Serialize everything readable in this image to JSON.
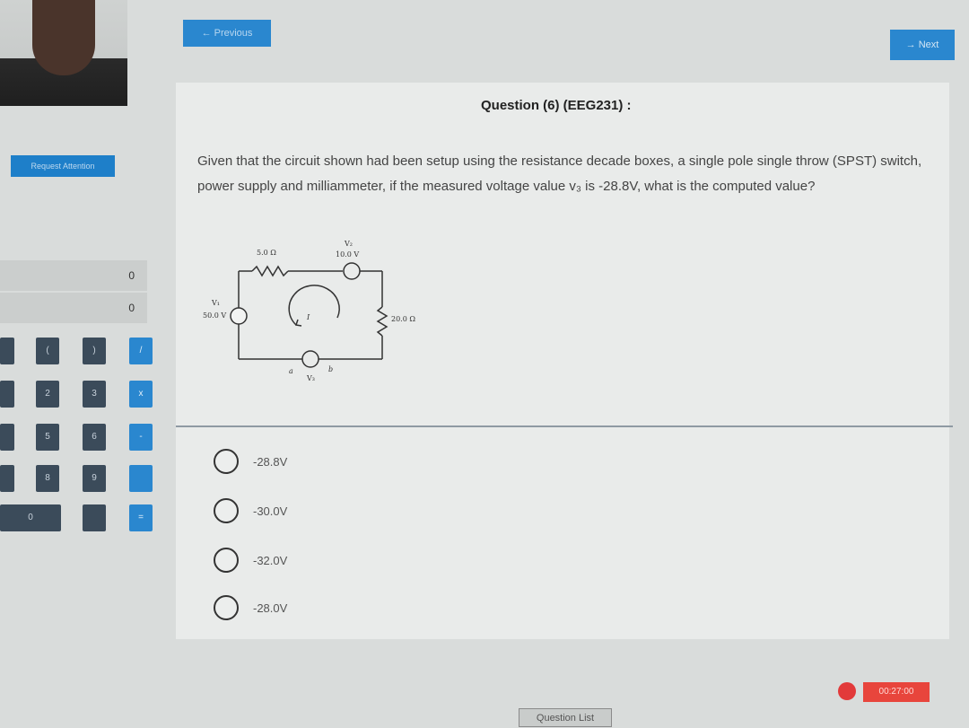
{
  "proctor": {
    "request_label": "Request Attention"
  },
  "nav": {
    "previous_label": "← Previous",
    "next_label": "→ Next"
  },
  "question": {
    "title": "Question (6) (EEG231) :",
    "text": "Given that the circuit shown had been setup using the resistance decade boxes, a single pole single throw (SPST) switch, power supply and milliammeter, if the measured voltage value v₃ is -28.8V, what is the computed value?",
    "circuit": {
      "r1_label": "5.0 Ω",
      "r2_label": "20.0 Ω",
      "v1_name": "V₁",
      "v1_value": "50.0 V",
      "v2_name": "V₂",
      "v2_value": "10.0 V",
      "current_label": "I",
      "node_a": "a",
      "node_b": "b",
      "v3_name": "V₃"
    },
    "options": [
      "-28.8V",
      "-30.0V",
      "-32.0V",
      "-28.0V"
    ]
  },
  "calculator": {
    "display_top": "0",
    "display_bottom": "0",
    "keys": [
      [
        "(",
        ")",
        "/"
      ],
      [
        "2",
        "3",
        "x"
      ],
      [
        "5",
        "6",
        "-"
      ],
      [
        "8",
        "9",
        ""
      ],
      [
        "0",
        "",
        "="
      ]
    ]
  },
  "footer": {
    "question_list_label": "Question List",
    "timer": "00:27:00"
  },
  "colors": {
    "accent": "#2a87cf",
    "timer_red": "#e8453c"
  }
}
